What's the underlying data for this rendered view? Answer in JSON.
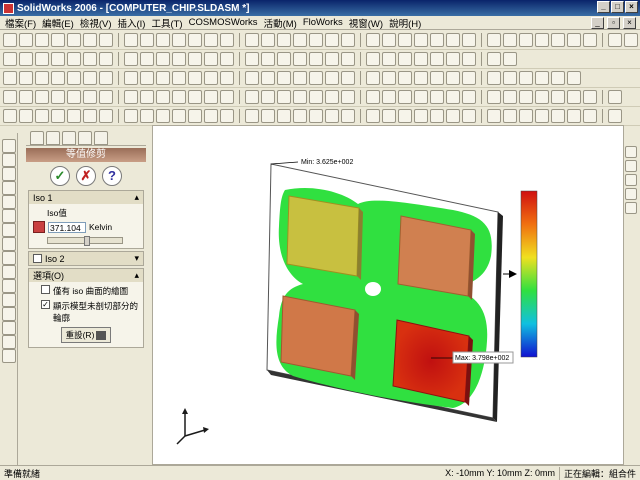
{
  "window": {
    "title": "SolidWorks 2006 - [COMPUTER_CHIP.SLDASM *]"
  },
  "menu": [
    "檔案(F)",
    "編輯(E)",
    "檢視(V)",
    "插入(I)",
    "工具(T)",
    "COSMOSWorks",
    "活動(M)",
    "FloWorks",
    "視窗(W)",
    "說明(H)"
  ],
  "panel": {
    "title": "等值修剪",
    "iso1": {
      "label": "Iso 1",
      "value_label": "Iso值",
      "value": "371.104",
      "unit": "Kelvin"
    },
    "iso2": {
      "label": "Iso 2"
    },
    "options": {
      "label": "選項(O)",
      "opt1": "僅有 iso 曲面的繪圖",
      "opt2": "顯示模型未剖切部分的輪廓",
      "reset": "重設(R)"
    }
  },
  "plot": {
    "min_label": "Min: 3.625e+002",
    "max_label": "Max: 3.798e+002",
    "colors": {
      "high": "#d01010",
      "mid": "#f0e020",
      "low": "#1010d0",
      "green": "#30e040"
    }
  },
  "status": {
    "ready": "準備就緒",
    "coords": "X: -10mm  Y: 10mm  Z: 0mm",
    "mode": "正在編輯：組合件"
  }
}
